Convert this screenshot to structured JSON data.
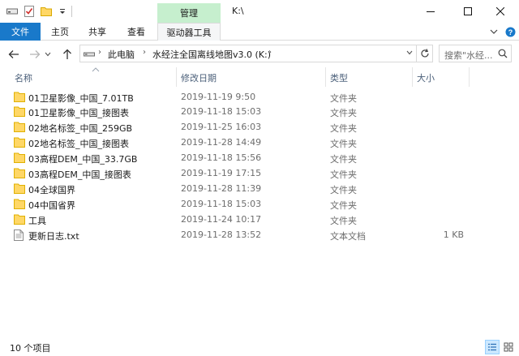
{
  "window": {
    "title": "K:\\",
    "context_tab": "管理"
  },
  "ribbon": {
    "tabs": [
      "文件",
      "主页",
      "共享",
      "查看",
      "驱动器工具"
    ]
  },
  "address": {
    "breadcrumbs": [
      "此电脑",
      "水经注全国离线地图v3.0 (K:)"
    ],
    "search_placeholder": "搜索\"水经..."
  },
  "columns": {
    "name": "名称",
    "date": "修改日期",
    "type": "类型",
    "size": "大小"
  },
  "files": [
    {
      "name": "01卫星影像_中国_7.01TB",
      "date": "2019-11-19 9:50",
      "type": "文件夹",
      "size": "",
      "icon": "folder-icon"
    },
    {
      "name": "01卫星影像_中国_接图表",
      "date": "2019-11-18 15:03",
      "type": "文件夹",
      "size": "",
      "icon": "folder-icon"
    },
    {
      "name": "02地名标签_中国_259GB",
      "date": "2019-11-25 16:03",
      "type": "文件夹",
      "size": "",
      "icon": "folder-icon"
    },
    {
      "name": "02地名标签_中国_接图表",
      "date": "2019-11-28 14:49",
      "type": "文件夹",
      "size": "",
      "icon": "folder-icon"
    },
    {
      "name": "03高程DEM_中国_33.7GB",
      "date": "2019-11-18 15:56",
      "type": "文件夹",
      "size": "",
      "icon": "folder-icon"
    },
    {
      "name": "03高程DEM_中国_接图表",
      "date": "2019-11-19 17:15",
      "type": "文件夹",
      "size": "",
      "icon": "folder-icon"
    },
    {
      "name": "04全球国界",
      "date": "2019-11-28 11:39",
      "type": "文件夹",
      "size": "",
      "icon": "folder-icon"
    },
    {
      "name": "04中国省界",
      "date": "2019-11-18 15:03",
      "type": "文件夹",
      "size": "",
      "icon": "folder-icon"
    },
    {
      "name": "工具",
      "date": "2019-11-24 10:17",
      "type": "文件夹",
      "size": "",
      "icon": "folder-icon"
    },
    {
      "name": "更新日志.txt",
      "date": "2019-11-28 13:52",
      "type": "文本文档",
      "size": "1 KB",
      "icon": "text-file-icon"
    }
  ],
  "status": {
    "item_count": "10 个项目"
  },
  "colors": {
    "file_tab": "#1979ca",
    "context_tab": "#c6efce",
    "folder": "#ffd766",
    "header_text": "#4c607a"
  }
}
